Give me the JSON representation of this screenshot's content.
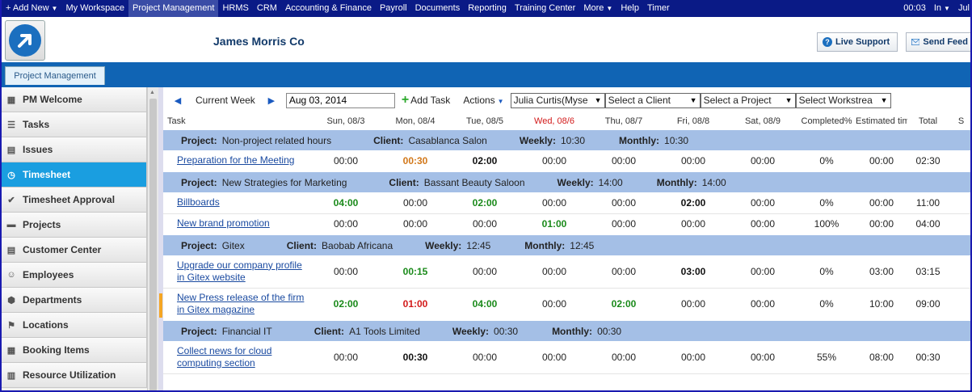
{
  "topnav": {
    "items": [
      {
        "label": "+ Add New",
        "caret": true
      },
      {
        "label": "My Workspace"
      },
      {
        "label": "Project Management",
        "active": true
      },
      {
        "label": "HRMS"
      },
      {
        "label": "CRM"
      },
      {
        "label": "Accounting & Finance"
      },
      {
        "label": "Payroll"
      },
      {
        "label": "Documents"
      },
      {
        "label": "Reporting"
      },
      {
        "label": "Training Center"
      },
      {
        "label": "More",
        "caret": true
      },
      {
        "label": "Help"
      },
      {
        "label": "Timer"
      }
    ],
    "right": {
      "timer": "00:03",
      "status": "In",
      "user": "Jul"
    }
  },
  "header": {
    "company": "James Morris Co",
    "live_support": "Live Support",
    "send_feedback": "Send Feed"
  },
  "tab": {
    "label": "Project Management"
  },
  "sidebar": {
    "items": [
      {
        "label": "PM Welcome",
        "icon": "grid-icon"
      },
      {
        "label": "Tasks",
        "icon": "list-icon"
      },
      {
        "label": "Issues",
        "icon": "document-icon"
      },
      {
        "label": "Timesheet",
        "icon": "clock-icon",
        "active": true
      },
      {
        "label": "Timesheet Approval",
        "icon": "check-icon"
      },
      {
        "label": "Projects",
        "icon": "folder-icon"
      },
      {
        "label": "Customer Center",
        "icon": "customer-icon"
      },
      {
        "label": "Employees",
        "icon": "employee-icon"
      },
      {
        "label": "Departments",
        "icon": "cube-icon"
      },
      {
        "label": "Locations",
        "icon": "flag-icon"
      },
      {
        "label": "Booking Items",
        "icon": "booking-icon"
      },
      {
        "label": "Resource Utilization",
        "icon": "resource-icon"
      }
    ]
  },
  "toolbar": {
    "current_week": "Current Week",
    "date": "Aug 03, 2014",
    "add_task": "Add Task",
    "actions": "Actions",
    "employee": "Julia Curtis(Myse",
    "client": "Select a Client",
    "project": "Select a Project",
    "workstream": "Select Workstrea"
  },
  "columns": [
    "Task",
    "Sun, 08/3",
    "Mon, 08/4",
    "Tue, 08/5",
    "Wed, 08/6",
    "Thu, 08/7",
    "Fri, 08/8",
    "Sat, 08/9",
    "Completed%",
    "Estimated tim",
    "Total",
    "S"
  ],
  "today_index": 4,
  "groups": [
    {
      "project_label": "Project:",
      "project": "Non-project related hours",
      "client_label": "Client:",
      "client": "Casablanca Salon",
      "weekly_label": "Weekly:",
      "weekly": "10:30",
      "monthly_label": "Monthly:",
      "monthly": "10:30",
      "tasks": [
        {
          "name": "Preparation for the Meeting",
          "days": [
            "00:00",
            "00:30",
            "02:00",
            "00:00",
            "00:00",
            "00:00",
            "00:00"
          ],
          "styles": [
            "",
            "orange",
            "bold",
            "",
            "",
            "",
            ""
          ],
          "completed": "0%",
          "estimated": "00:00",
          "total": "02:30"
        }
      ]
    },
    {
      "project_label": "Project:",
      "project": "New Strategies for Marketing",
      "client_label": "Client:",
      "client": "Bassant Beauty Saloon",
      "weekly_label": "Weekly:",
      "weekly": "14:00",
      "monthly_label": "Monthly:",
      "monthly": "14:00",
      "tasks": [
        {
          "name": "Billboards",
          "days": [
            "04:00",
            "00:00",
            "02:00",
            "00:00",
            "00:00",
            "02:00",
            "00:00"
          ],
          "styles": [
            "green",
            "",
            "green",
            "",
            "",
            "bold",
            ""
          ],
          "completed": "0%",
          "estimated": "00:00",
          "total": "11:00"
        },
        {
          "name": "New brand promotion",
          "days": [
            "00:00",
            "00:00",
            "00:00",
            "01:00",
            "00:00",
            "00:00",
            "00:00"
          ],
          "styles": [
            "",
            "",
            "",
            "green",
            "",
            "",
            ""
          ],
          "completed": "100%",
          "estimated": "00:00",
          "total": "04:00"
        }
      ]
    },
    {
      "project_label": "Project:",
      "project": "Gitex",
      "client_label": "Client:",
      "client": "Baobab Africana",
      "weekly_label": "Weekly:",
      "weekly": "12:45",
      "monthly_label": "Monthly:",
      "monthly": "12:45",
      "tasks": [
        {
          "name": "Upgrade our company profile in Gitex website",
          "days": [
            "00:00",
            "00:15",
            "00:00",
            "00:00",
            "00:00",
            "03:00",
            "00:00"
          ],
          "styles": [
            "",
            "green",
            "",
            "",
            "",
            "bold",
            ""
          ],
          "completed": "0%",
          "estimated": "03:00",
          "total": "03:15"
        },
        {
          "name": "New Press release of the firm in Gitex magazine",
          "days": [
            "02:00",
            "01:00",
            "04:00",
            "00:00",
            "02:00",
            "00:00",
            "00:00"
          ],
          "styles": [
            "green",
            "red",
            "green",
            "",
            "green",
            "",
            ""
          ],
          "completed": "0%",
          "estimated": "10:00",
          "total": "09:00"
        }
      ]
    },
    {
      "project_label": "Project:",
      "project": "Financial IT",
      "client_label": "Client:",
      "client": "A1 Tools Limited",
      "weekly_label": "Weekly:",
      "weekly": "00:30",
      "monthly_label": "Monthly:",
      "monthly": "00:30",
      "tasks": [
        {
          "name": "Collect news for cloud computing section",
          "days": [
            "00:00",
            "00:30",
            "00:00",
            "00:00",
            "00:00",
            "00:00",
            "00:00"
          ],
          "styles": [
            "",
            "bold",
            "",
            "",
            "",
            "",
            ""
          ],
          "completed": "55%",
          "estimated": "08:00",
          "total": "00:30"
        }
      ]
    }
  ]
}
